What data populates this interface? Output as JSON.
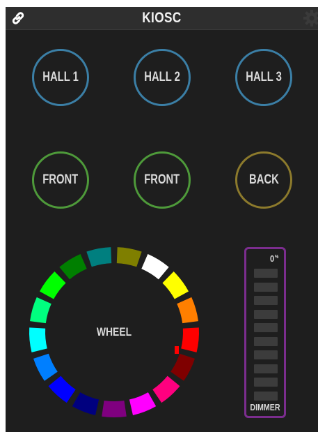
{
  "app": {
    "title": "KIOSC",
    "icons": {
      "left": "link-icon",
      "right": "gear-icon"
    }
  },
  "buttons": {
    "row1": [
      {
        "label": "HALL 1",
        "color": "#3b7fa6"
      },
      {
        "label": "HALL 2",
        "color": "#3b7fa6"
      },
      {
        "label": "HALL 3",
        "color": "#3b7fa6"
      }
    ],
    "row2": [
      {
        "label": "FRONT",
        "color": "#4e9a3a"
      },
      {
        "label": "FRONT",
        "color": "#4e9a3a"
      },
      {
        "label": "BACK",
        "color": "#8c7a2c"
      }
    ]
  },
  "wheel": {
    "label": "WHEEL",
    "segment_colors": [
      "#7f7f00",
      "#ffffff",
      "#ffff00",
      "#ff7f00",
      "#ff0000",
      "#7f0000",
      "#ff007f",
      "#ff00ff",
      "#7f007f",
      "#00007f",
      "#0000ff",
      "#007fff",
      "#00ffff",
      "#00ff7f",
      "#00ff00",
      "#007f00",
      "#007f7f"
    ],
    "indicator_color": "#ff0000"
  },
  "dimmer": {
    "value": "0",
    "unit": "%",
    "label": "DIMMER",
    "level": 0,
    "segment_count": 10,
    "color": "#7b2d8e"
  }
}
